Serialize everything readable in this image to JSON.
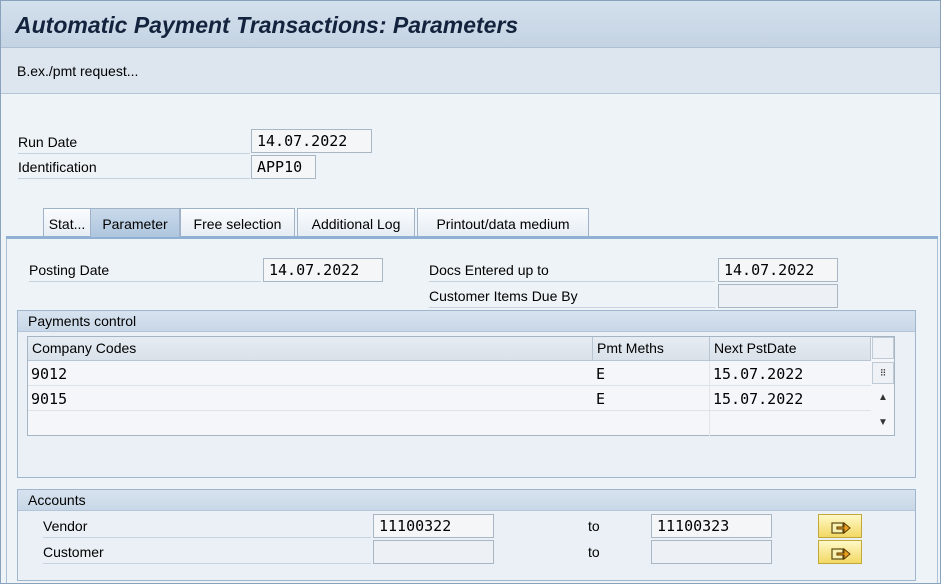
{
  "title": "Automatic Payment Transactions: Parameters",
  "toolbar": {
    "bex_label": "B.ex./pmt request..."
  },
  "header": {
    "run_date_label": "Run Date",
    "run_date_value": "14.07.2022",
    "identification_label": "Identification",
    "identification_value": "APP10"
  },
  "tabs": [
    {
      "label": "Stat..."
    },
    {
      "label": "Parameter",
      "active": true
    },
    {
      "label": "Free selection"
    },
    {
      "label": "Additional Log"
    },
    {
      "label": "Printout/data medium"
    }
  ],
  "parameter": {
    "posting_date_label": "Posting Date",
    "posting_date_value": "14.07.2022",
    "docs_entered_label": "Docs Entered up to",
    "docs_entered_value": "14.07.2022",
    "customer_items_label": "Customer Items Due By",
    "customer_items_value": ""
  },
  "payments_control": {
    "title": "Payments control",
    "columns": [
      "Company Codes",
      "Pmt Meths",
      "Next PstDate"
    ],
    "rows": [
      {
        "company_code": "9012",
        "pmt_meths": "E",
        "next_pst_date": "15.07.2022"
      },
      {
        "company_code": "9015",
        "pmt_meths": "E",
        "next_pst_date": "15.07.2022"
      }
    ]
  },
  "accounts": {
    "title": "Accounts",
    "to_label": "to",
    "vendor_label": "Vendor",
    "vendor_from": "11100322",
    "vendor_to": "11100323",
    "customer_label": "Customer",
    "customer_from": "",
    "customer_to": ""
  },
  "icons": {
    "multiple_selection": "multiple-selection-arrow-icon",
    "scroll_up": "scroll-up-icon",
    "scroll_down": "scroll-down-icon",
    "column_settings": "column-settings-icon"
  },
  "colors": {
    "button_yellow": "#f2d863",
    "active_tab": "#aec6de",
    "title_bar": "#c4d3e3"
  }
}
